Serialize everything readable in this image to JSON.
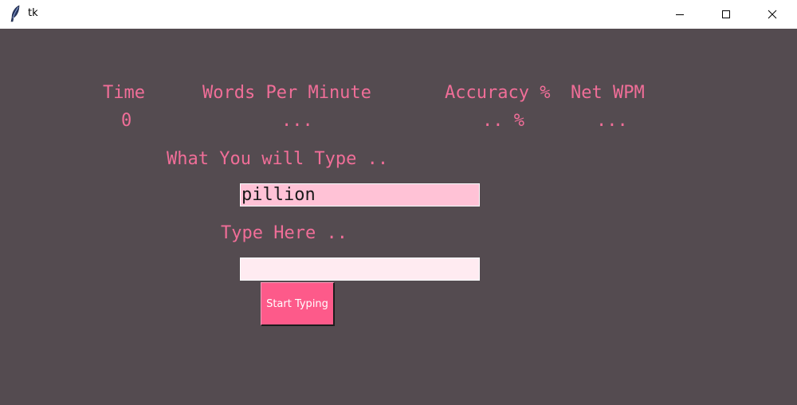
{
  "window": {
    "title": "tk",
    "icon": "feather-icon",
    "controls": [
      "minimize-icon",
      "maximize-icon",
      "close-icon"
    ]
  },
  "stats": {
    "time_label": "Time",
    "time_value": "0",
    "wpm_label": "Words Per Minute",
    "wpm_value": "...",
    "accuracy_label": "Accuracy %",
    "accuracy_value": ".. %",
    "net_wpm_label": "Net WPM",
    "net_wpm_value": "..."
  },
  "prompt": {
    "label": "What You will Type ..",
    "word": "pillion"
  },
  "typing": {
    "label": "Type Here ..",
    "value": ""
  },
  "start_button": {
    "label": "Start Typing"
  },
  "colors": {
    "background": "#544b50",
    "label_pink": "#f06e98",
    "target_entry": "#ffc2d6",
    "typing_entry": "#ffebf1",
    "button": "#fd5a8a"
  }
}
